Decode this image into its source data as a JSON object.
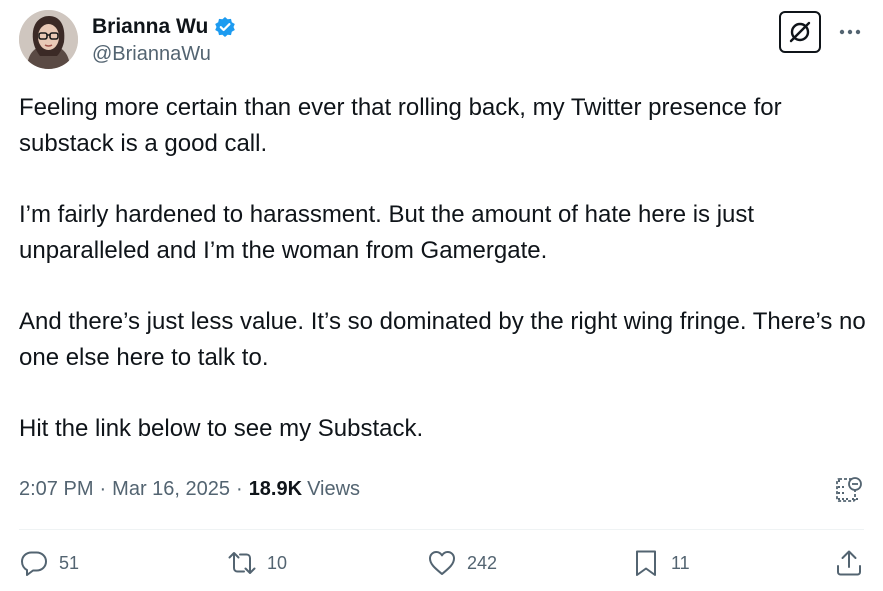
{
  "author": {
    "display_name": "Brianna Wu",
    "handle": "@BriannaWu",
    "verified": true
  },
  "tweet": {
    "paragraphs": [
      "Feeling more certain than ever that rolling back, my Twitter presence for substack is a good call.",
      "I’m fairly hardened to harassment. But the amount of hate here is just unparalleled and I’m the woman from Gamergate.",
      "And there’s just less value. It’s so dominated by the right wing fringe. There’s no one else here to talk to.",
      "Hit the link below to see my Substack."
    ]
  },
  "meta": {
    "time": "2:07 PM",
    "date": "Mar 16, 2025",
    "separator": "·",
    "views_count": "18.9K",
    "views_label": "Views"
  },
  "actions": {
    "replies": "51",
    "reposts": "10",
    "likes": "242",
    "bookmarks": "11"
  },
  "icons": {
    "verified": "verified-badge-icon",
    "grok": "grok-icon",
    "more": "more-dots-icon",
    "analytics": "analytics-icon",
    "reply": "reply-icon",
    "repost": "repost-icon",
    "like": "heart-icon",
    "bookmark": "bookmark-icon",
    "share": "share-icon"
  },
  "colors": {
    "text": "#0f1419",
    "secondary": "#536471",
    "verified": "#1d9bf0",
    "divider": "#eff3f4"
  }
}
